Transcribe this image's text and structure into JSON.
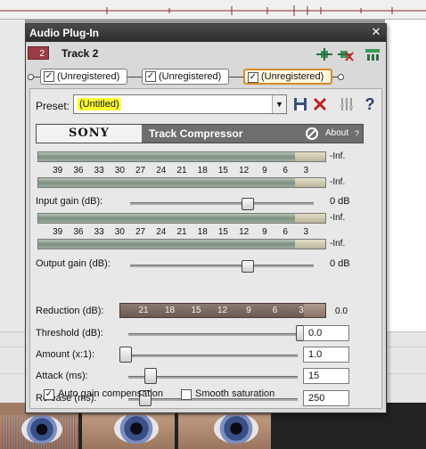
{
  "window": {
    "title": "Audio Plug-In"
  },
  "track": {
    "number": "2",
    "name": "Track 2"
  },
  "chain": {
    "plugins": [
      {
        "label": "(Unregistered)",
        "checked": true,
        "active": false
      },
      {
        "label": "(Unregistered)",
        "checked": true,
        "active": false
      },
      {
        "label": "(Unregistered)",
        "checked": true,
        "active": true
      }
    ],
    "icons": [
      "plugin-chain-icon",
      "remove-plugin-icon",
      "bypass-icon"
    ]
  },
  "preset": {
    "label": "Preset:",
    "value": "(Untitled)"
  },
  "header": {
    "brand": "SONY",
    "plugin_name": "Track Compressor",
    "about_label": "About",
    "about_q": "?"
  },
  "meter": {
    "inf": "-Inf.",
    "scale": [
      "39",
      "36",
      "33",
      "30",
      "27",
      "24",
      "21",
      "18",
      "15",
      "12",
      "9",
      "6",
      "3"
    ]
  },
  "input_gain": {
    "label": "Input gain (dB):",
    "value": "0 dB",
    "fraction": 0.65
  },
  "output_gain": {
    "label": "Output gain (dB):",
    "value": "0 dB",
    "fraction": 0.65
  },
  "reduction": {
    "label": "Reduction (dB):",
    "scale": [
      "21",
      "18",
      "15",
      "12",
      "9",
      "6",
      "3"
    ],
    "value": "0.0"
  },
  "threshold": {
    "label": "Threshold (dB):",
    "value": "0.0",
    "fraction": 1.0
  },
  "amount": {
    "label": "Amount (x:1):",
    "value": "1.0",
    "fraction": 0.0
  },
  "attack": {
    "label": "Attack (ms):",
    "value": "15",
    "fraction": 0.14
  },
  "release": {
    "label": "Release (ms):",
    "value": "250",
    "fraction": 0.11
  },
  "options": {
    "auto_gain": {
      "label": "Auto gain compensation",
      "checked": true
    },
    "smooth_saturation": {
      "label": "Smooth saturation",
      "checked": false
    }
  },
  "colors": {
    "track_badge": "#9b3b45",
    "preset_highlight": "#ffff33",
    "active_plugin_border": "#d88a2a"
  }
}
